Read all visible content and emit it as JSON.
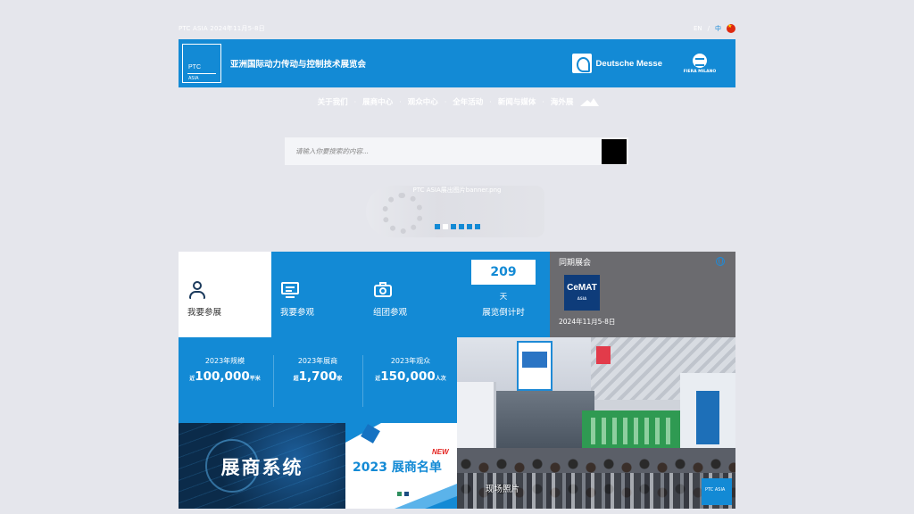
{
  "topbar": {
    "date_text": "PTC ASIA 2024年11月5-8日",
    "lang_en": "EN",
    "lang_sep": "/",
    "lang_zh": "中"
  },
  "header": {
    "logo_main": "PTC",
    "logo_sub": "ASIA",
    "title": "亚洲国际动力传动与控制技术展览会",
    "partner1": "Deutsche Messe",
    "partner2": "FIERA MILANO"
  },
  "nav": {
    "items": [
      "关于我们",
      "展商中心",
      "观众中心",
      "全年活动",
      "新闻与媒体",
      "海外展"
    ],
    "separator": "·"
  },
  "search": {
    "placeholder": "请输入你要搜索的内容..."
  },
  "banner": {
    "alt_text": "PTC ASIA展出图片banner.png",
    "slide_count": 6,
    "active_slide": 1
  },
  "tiles": {
    "exhibit": "我要参展",
    "visit": "我要参观",
    "group": "组团参观",
    "countdown": {
      "days": "209",
      "unit": "天",
      "label": "展览倒计时"
    },
    "concurrent": {
      "title": "同期展会",
      "logo_main": "CeMAT",
      "logo_sub": "ASIA",
      "date": "2024年11月5-8日"
    },
    "stats": [
      {
        "label": "2023年规模",
        "prefix": "近",
        "value": "100,000",
        "unit": "平米"
      },
      {
        "label": "2023年展商",
        "prefix": "超",
        "value": "1,700",
        "unit": "家"
      },
      {
        "label": "2023年观众",
        "prefix": "近",
        "value": "150,000",
        "unit": "人次"
      }
    ],
    "photo_label": "现场照片",
    "photo_badge": "PTC ASIA",
    "system_label": "展商系统",
    "list": {
      "new_tag": "NEW",
      "title": "2023 展商名单"
    }
  },
  "colors": {
    "brand_blue": "#138ad5",
    "background": "#e5e6ec",
    "concurrent_bg": "#6b6b6f"
  }
}
